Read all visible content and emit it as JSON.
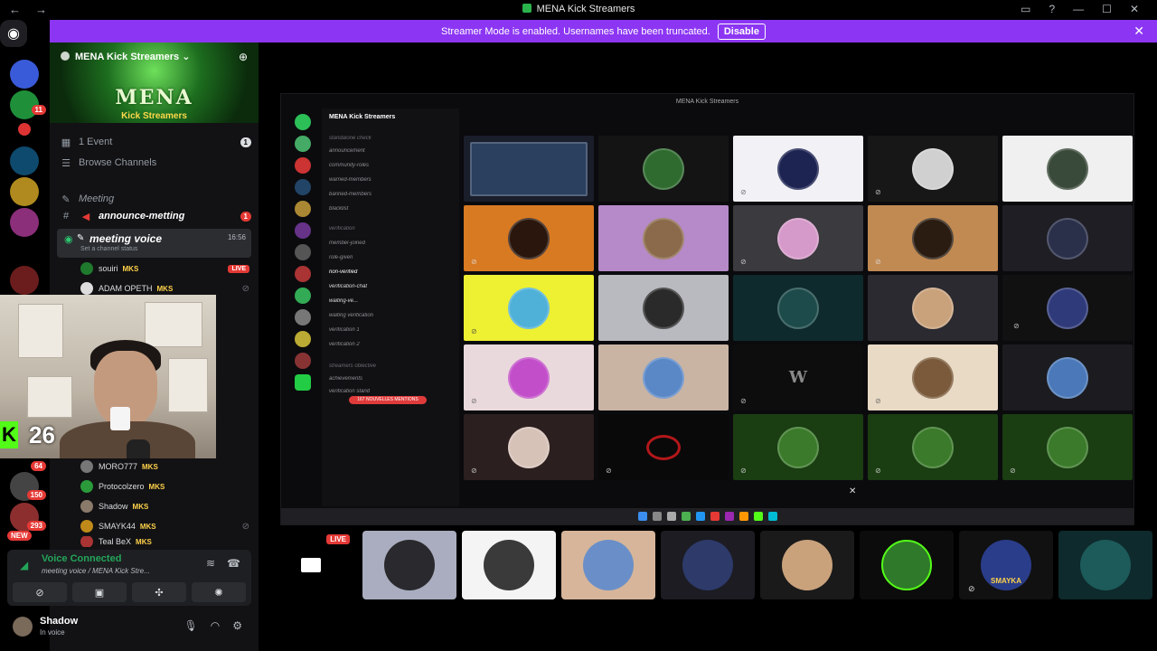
{
  "window": {
    "title": "MENA Kick Streamers"
  },
  "banner": {
    "message": "Streamer Mode is enabled. Usernames have been truncated.",
    "button": "Disable"
  },
  "rail": {
    "badges": [
      "11",
      "64",
      "150",
      "293",
      "NEW"
    ]
  },
  "sidebar": {
    "server_name": "MENA Kick Streamers",
    "logo_text": "MENA",
    "logo_sub": "Kick Streamers",
    "events": {
      "label": "1 Event",
      "count": "1"
    },
    "browse": "Browse Channels",
    "category": "Meeting",
    "announce": {
      "label": "announce-metting",
      "count": "1"
    },
    "voice_channel": {
      "label": "meeting voice",
      "time": "16:56",
      "status": "Set a channel status"
    },
    "members": [
      {
        "name": "souiri",
        "tag": "MKS",
        "live": "LIVE"
      },
      {
        "name": "ADAM OPETH",
        "tag": "MKS"
      },
      {
        "name": "MORO777",
        "tag": "MKS"
      },
      {
        "name": "Protocolzero",
        "tag": "MKS"
      },
      {
        "name": "Shadow",
        "tag": "MKS"
      },
      {
        "name": "SMAYK44",
        "tag": "MKS"
      },
      {
        "name": "Teal BeX",
        "tag": "MKS"
      }
    ]
  },
  "webcam": {
    "counter": "26"
  },
  "voice_panel": {
    "title": "Voice Connected",
    "subtitle": "meeting voice / MENA Kick Stre..."
  },
  "user": {
    "name": "Shadow",
    "status": "In voice"
  },
  "stream": {
    "title": "MENA Kick Streamers",
    "inner_server": "MENA Kick Streamers",
    "inner_channels": [
      "standalone check",
      "announcement",
      "community-roles",
      "warned-members",
      "banned-members",
      "blacklist",
      "verification",
      "member-joined",
      "role-given",
      "non-verified",
      "verification-chat",
      "waiting-ve...",
      "waiting verification",
      "verification 1",
      "verification 2",
      "streamers oblective",
      "achievements",
      "verification stand"
    ],
    "alert": "167 NOUVELLES MENTIONS",
    "tile_text": "W"
  },
  "strip": {
    "live": "LIVE",
    "smayka": "SMAYKA"
  },
  "colors": {
    "accent": "#8c36f3",
    "kick": "#53fc18",
    "online": "#23a55a",
    "danger": "#e53935"
  }
}
